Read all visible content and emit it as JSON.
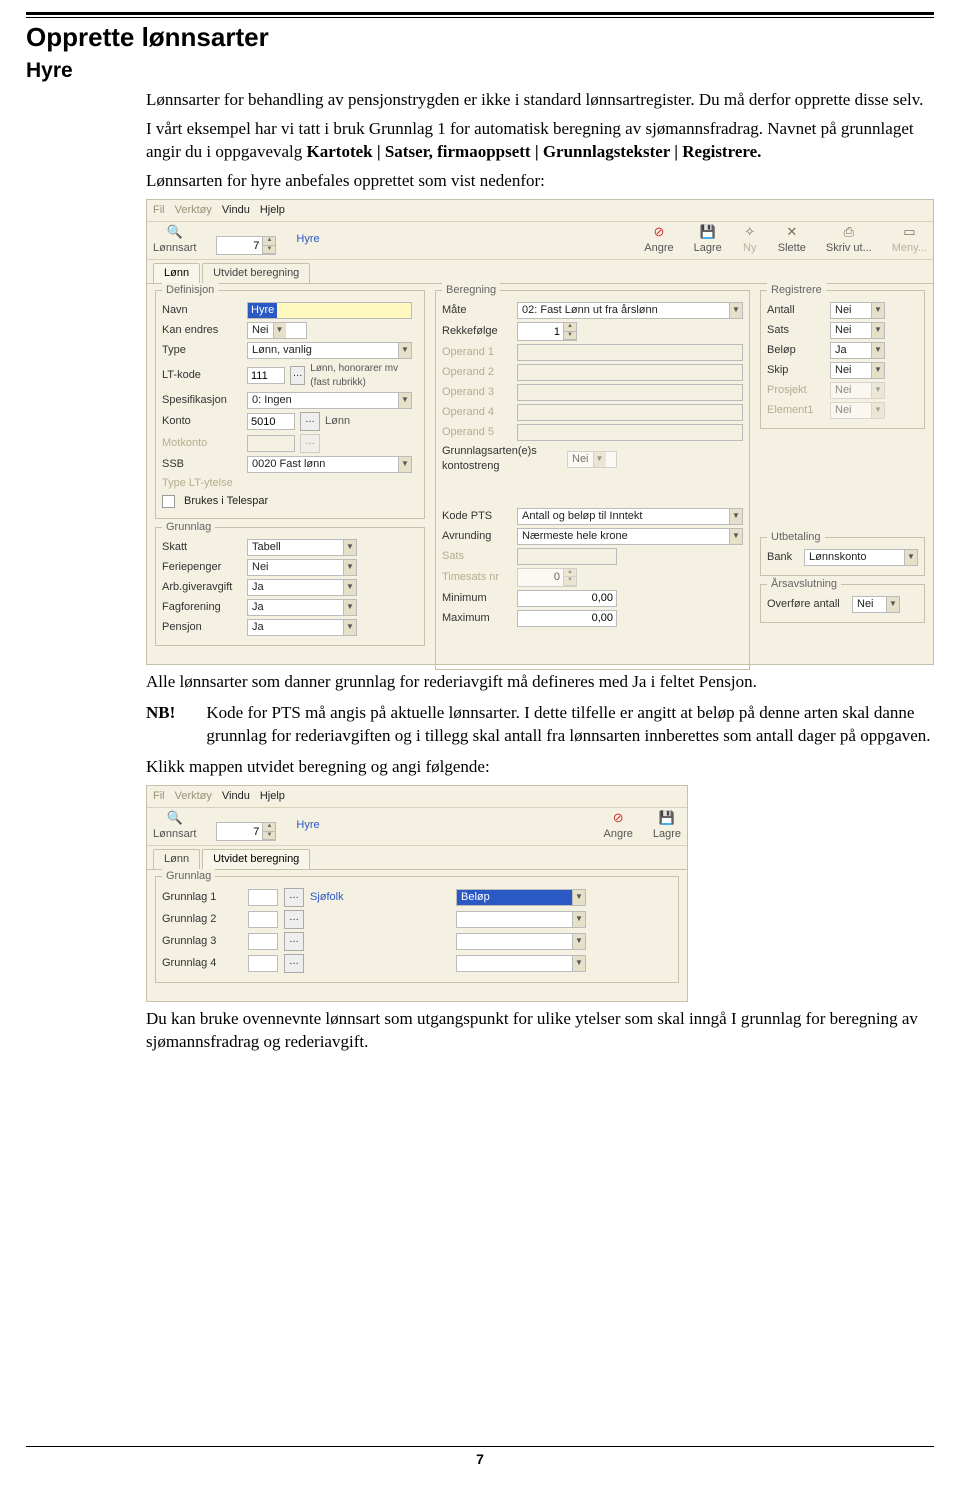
{
  "page_number": "7",
  "h1": "Opprette lønnsarter",
  "h2": "Hyre",
  "intro1": "Lønnsarter for behandling av pensjonstrygden er ikke i standard lønnsartregister. Du må derfor opprette disse selv.",
  "intro2a": "I vårt eksempel har vi tatt i bruk Grunnlag 1 for automatisk beregning av sjømannsfradrag. Navnet på grunnlaget angir du i oppgavevalg ",
  "intro2b": "Kartotek | Satser, firmaoppsett | Grunnlagstekster | Registrere.",
  "intro3": "Lønnsarten for hyre anbefales opprettet som vist nedenfor:",
  "after1": "Alle lønnsarter som danner grunnlag for rederiavgift må defineres med Ja i feltet Pensjon.",
  "nb_label": "NB!",
  "nb_text": "Kode for PTS må angis på aktuelle lønnsarter. I dette tilfelle er angitt at beløp på denne arten skal danne grunnlag for rederiavgiften og i tillegg skal antall fra lønnsarten innberettes som antall dager på oppgaven.",
  "after2": "Klikk mappen utvidet beregning og angi følgende:",
  "after3": "Du kan bruke ovennevnte lønnsart som utgangspunkt for ulike ytelser som skal inngå I grunnlag for beregning av sjømannsfradrag og rederiavgift.",
  "ui1": {
    "menu": {
      "fil": "Fil",
      "verktoy": "Verktøy",
      "vindu": "Vindu",
      "hjelp": "Hjelp"
    },
    "toolbar": {
      "lonnsart": "Lønnsart",
      "id": "7",
      "title": "Hyre",
      "angre": "Angre",
      "lagre": "Lagre",
      "ny": "Ny",
      "slette": "Slette",
      "skriv": "Skriv ut...",
      "meny": "Meny..."
    },
    "tabs": {
      "lonn": "Lønn",
      "utvidet": "Utvidet beregning"
    },
    "def": {
      "title": "Definisjon",
      "navn": "Navn",
      "navn_v": "Hyre",
      "kan_endres": "Kan endres",
      "kan_endres_v": "Nei",
      "type": "Type",
      "type_v": "Lønn, vanlig",
      "lt": "LT-kode",
      "lt_v": "111",
      "lt_desc": "Lønn, honorarer  mv (fast rubrikk)",
      "spes": "Spesifikasjon",
      "spes_v": "0: Ingen",
      "konto": "Konto",
      "konto_v": "5010",
      "konto_desc": "Lønn",
      "motkonto": "Motkonto",
      "ssb": "SSB",
      "ssb_v": "0020 Fast lønn",
      "type_lt": "Type LT-ytelse",
      "telespar": "Brukes i Telespar"
    },
    "grunnlag": {
      "title": "Grunnlag",
      "skatt": "Skatt",
      "skatt_v": "Tabell",
      "ferie": "Feriepenger",
      "ferie_v": "Nei",
      "arb": "Arb.giveravgift",
      "arb_v": "Ja",
      "fag": "Fagforening",
      "fag_v": "Ja",
      "pensjon": "Pensjon",
      "pensjon_v": "Ja"
    },
    "bereg": {
      "title": "Beregning",
      "mate": "Måte",
      "mate_v": "02: Fast Lønn ut fra årslønn",
      "rekke": "Rekkefølge",
      "rekke_v": "1",
      "op1": "Operand 1",
      "op2": "Operand 2",
      "op3": "Operand 3",
      "op4": "Operand 4",
      "op5": "Operand 5",
      "konto_string": "Grunnlagsarten(e)s kontostreng",
      "konto_string_v": "Nei",
      "kode_pts": "Kode PTS",
      "kode_pts_v": "Antall og beløp til Inntekt",
      "avrund": "Avrunding",
      "avrund_v": "Nærmeste hele krone",
      "sats": "Sats",
      "time": "Timesats nr",
      "time_v": "0",
      "min": "Minimum",
      "min_v": "0,00",
      "max": "Maximum",
      "max_v": "0,00"
    },
    "reg": {
      "title": "Registrere",
      "antall": "Antall",
      "antall_v": "Nei",
      "sats": "Sats",
      "sats_v": "Nei",
      "belop": "Beløp",
      "belop_v": "Ja",
      "skip": "Skip",
      "skip_v": "Nei",
      "prosjekt": "Prosjekt",
      "prosjekt_v": "Nei",
      "element": "Element1",
      "element_v": "Nei"
    },
    "utbet": {
      "title": "Utbetaling",
      "bank": "Bank",
      "bank_v": "Lønnskonto"
    },
    "ars": {
      "title": "Årsavslutning",
      "overfore": "Overføre antall",
      "overfore_v": "Nei"
    }
  },
  "ui2": {
    "menu": {
      "fil": "Fil",
      "verktoy": "Verktøy",
      "vindu": "Vindu",
      "hjelp": "Hjelp"
    },
    "toolbar": {
      "lonnsart": "Lønnsart",
      "id": "7",
      "title": "Hyre",
      "angre": "Angre",
      "lagre": "Lagre"
    },
    "tabs": {
      "lonn": "Lønn",
      "utvidet": "Utvidet beregning"
    },
    "grunnlag": {
      "title": "Grunnlag",
      "g1": "Grunnlag 1",
      "g1_desc": "Sjøfolk",
      "g1_dd": "Beløp",
      "g2": "Grunnlag 2",
      "g3": "Grunnlag 3",
      "g4": "Grunnlag 4"
    }
  }
}
